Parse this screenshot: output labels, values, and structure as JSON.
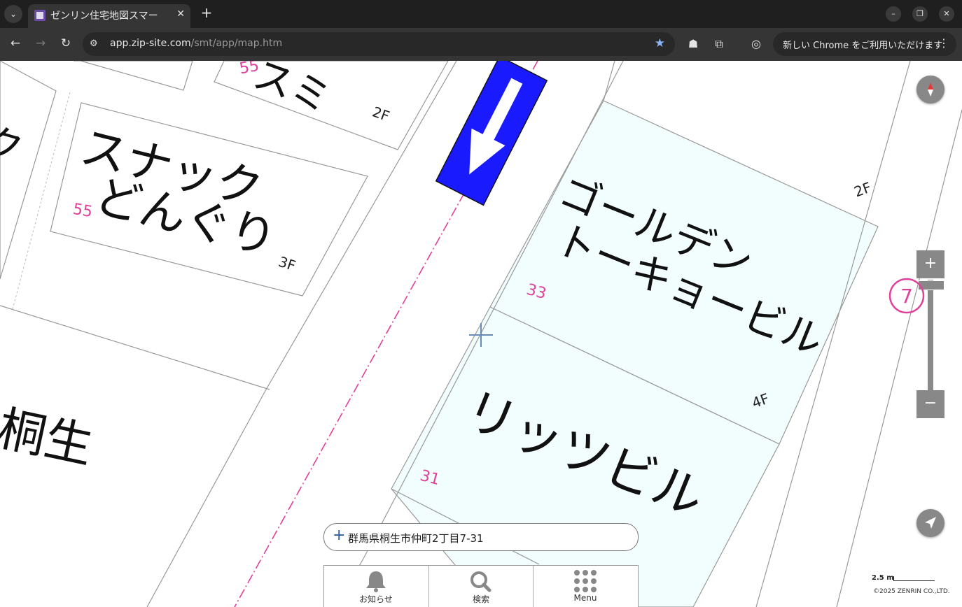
{
  "browser": {
    "tab_title": "ゼンリン住宅地図スマー",
    "url_host": "app.zip-site.com",
    "url_path": "/smt/app/map.htm",
    "update_text": "新しい Chrome をご利用いただけます"
  },
  "map": {
    "labels": {
      "snack_line1": "スナック",
      "snack_line2": "どんぐり",
      "golden_line1": "ゴールデン",
      "golden_line2": "トーキョービル",
      "ritz": "リッツビル",
      "kiryu_line1": "桐生",
      "top_partial": "スミ",
      "left_partial": "ク"
    },
    "numbers": {
      "n55_top": "55",
      "n55_left": "55",
      "n33": "33",
      "n31": "31"
    },
    "floors": {
      "f2_top": "2F",
      "f3": "3F",
      "f2_right": "2F",
      "f4": "4F"
    },
    "zoom_level_marker": "7",
    "address": "群馬県桐生市仲町2丁目7-31",
    "scale": "2.5 m",
    "copyright": "©2025 ZENRIN CO.,LTD."
  },
  "controls": {
    "zoom_in": "+",
    "zoom_out": "−",
    "bottom_menu": [
      {
        "label": "お知らせ",
        "icon": "bell-icon"
      },
      {
        "label": "検索",
        "icon": "search-icon"
      },
      {
        "label": "Menu",
        "icon": "grid-icon"
      }
    ]
  },
  "colors": {
    "accent_blue": "#1a1aff",
    "parcel_tint": "#f2fdfd",
    "number_pink": "#e0409a"
  }
}
